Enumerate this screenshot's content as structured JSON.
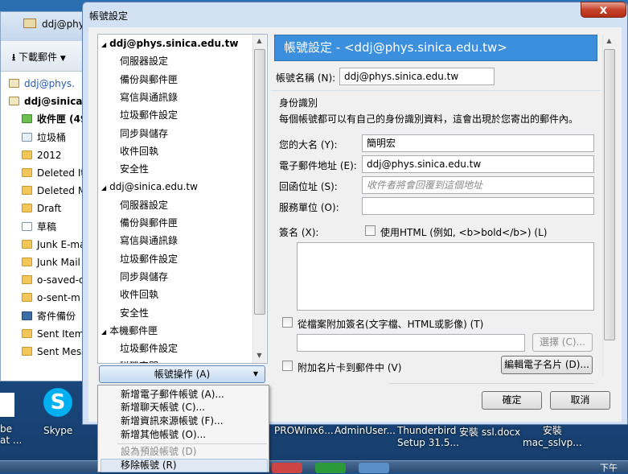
{
  "desktop": {
    "icons": [
      {
        "label": "Skype"
      },
      {
        "label": "be"
      },
      {
        "label": "at ..."
      }
    ],
    "taskbar_items": [
      "PROWinx6...",
      "AdminUser...",
      "Thunderbird\nSetup 31.5...",
      "安裝 ssl.docx",
      "安裝\nmac_sslvp..."
    ],
    "clock": "下午"
  },
  "thunderbird": {
    "window_title": "ddj@phy",
    "toolbar_get_mail": "下載郵件",
    "folders": [
      {
        "label": "ddj@phys.",
        "type": "account"
      },
      {
        "label": "ddj@sinica",
        "type": "account"
      },
      {
        "label": "收件匣 (49",
        "type": "inbox"
      },
      {
        "label": "垃圾桶",
        "type": "trash"
      },
      {
        "label": "2012",
        "type": "folder"
      },
      {
        "label": "Deleted It",
        "type": "folder"
      },
      {
        "label": "Deleted M",
        "type": "folder"
      },
      {
        "label": "Draft",
        "type": "folder"
      },
      {
        "label": "草稿",
        "type": "drafts"
      },
      {
        "label": "Junk E-ma",
        "type": "folder"
      },
      {
        "label": "Junk Mail",
        "type": "folder"
      },
      {
        "label": "o-saved-c",
        "type": "folder"
      },
      {
        "label": "o-sent-m",
        "type": "folder"
      },
      {
        "label": "寄件備份",
        "type": "sent"
      },
      {
        "label": "Sent Item",
        "type": "folder"
      },
      {
        "label": "Sent Mess",
        "type": "folder"
      }
    ]
  },
  "dialog": {
    "title": "帳號設定",
    "close_label": "x",
    "tree": {
      "accounts": [
        {
          "name": "ddj@phys.sinica.edu.tw",
          "items": [
            "伺服器設定",
            "備份與郵件匣",
            "寫信與通訊錄",
            "垃圾郵件設定",
            "同步與儲存",
            "收件回執",
            "安全性"
          ]
        },
        {
          "name": "ddj@sinica.edu.tw",
          "items": [
            "伺服器設定",
            "備份與郵件匣",
            "寫信與通訊錄",
            "垃圾郵件設定",
            "同步與儲存",
            "收件回執",
            "安全性"
          ]
        },
        {
          "name": "本機郵件匣",
          "items": [
            "垃圾郵件設定",
            "磁碟空間"
          ]
        }
      ]
    },
    "account_actions": {
      "label": "帳號操作 (A)",
      "menu": [
        {
          "label": "新增電子郵件帳號 (A)...",
          "enabled": true
        },
        {
          "label": "新增聊天帳號 (C)...",
          "enabled": true
        },
        {
          "label": "新增資訊來源帳號 (F)...",
          "enabled": true
        },
        {
          "label": "新增其他帳號 (O)...",
          "enabled": true
        },
        {
          "label": "設為預設帳號 (D)",
          "enabled": false
        },
        {
          "label": "移除帳號 (R)",
          "enabled": true,
          "highlighted": true
        }
      ]
    },
    "panel": {
      "header": "帳號設定 - <ddj@phys.sinica.edu.tw>",
      "account_name_label": "帳號名稱 (N):",
      "account_name_value": "ddj@phys.sinica.edu.tw",
      "identity_group": "身份識別",
      "identity_desc": "每個帳號都可以有自己的身份識別資料，這會出現於您寄出的郵件內。",
      "your_name_label": "您的大名 (Y):",
      "your_name_value": "簡明宏",
      "email_label": "電子郵件地址 (E):",
      "email_value": "ddj@phys.sinica.edu.tw",
      "reply_to_label": "回函位址 (S):",
      "reply_to_placeholder": "收件者將會回覆到這個地址",
      "org_label": "服務單位 (O):",
      "org_value": "",
      "signature_label": "簽名 (X):",
      "use_html_label": "使用HTML (例如, <b>bold</b>) (L)",
      "use_html_checked": false,
      "attach_sig_label": "從檔案附加簽名(文字檔、HTML或影像) (T)",
      "attach_sig_checked": false,
      "choose_label": "選擇 (C)...",
      "attach_vcard_label": "附加名片卡到郵件中 (V)",
      "attach_vcard_checked": false,
      "edit_vcard_label": "編輯電子名片 (D)..."
    },
    "ok_label": "確定",
    "cancel_label": "取消"
  }
}
